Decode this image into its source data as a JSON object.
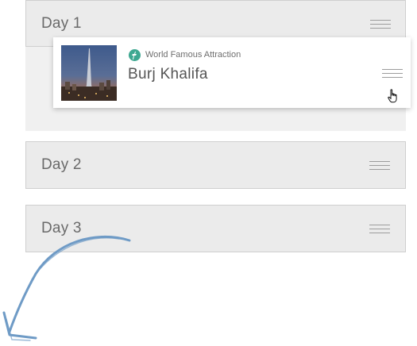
{
  "days": [
    {
      "label": "Day 1"
    },
    {
      "label": "Day 2"
    },
    {
      "label": "Day 3"
    }
  ],
  "item": {
    "category": "World Famous Attraction",
    "title": "Burj Khalifa",
    "category_icon": "attraction-badge-icon",
    "thumbnail": "burj-khalifa-photo"
  },
  "colors": {
    "accent": "#3ea891",
    "arrow": "#6f9bc6",
    "panel": "#ebebeb"
  }
}
